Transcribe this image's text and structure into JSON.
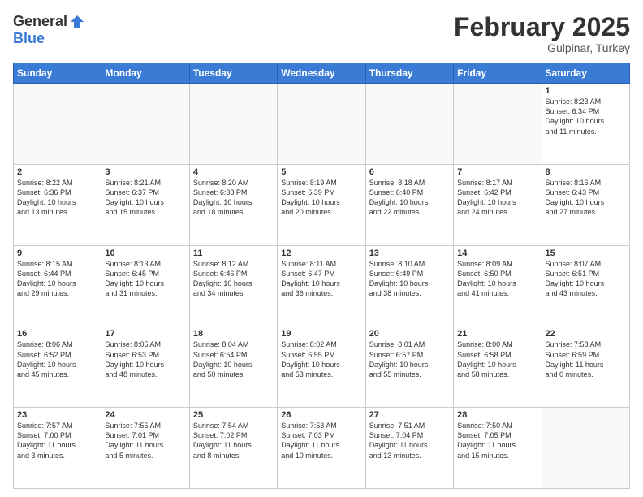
{
  "logo": {
    "general": "General",
    "blue": "Blue"
  },
  "header": {
    "title": "February 2025",
    "subtitle": "Gulpinar, Turkey"
  },
  "weekdays": [
    "Sunday",
    "Monday",
    "Tuesday",
    "Wednesday",
    "Thursday",
    "Friday",
    "Saturday"
  ],
  "weeks": [
    [
      {
        "day": "",
        "info": ""
      },
      {
        "day": "",
        "info": ""
      },
      {
        "day": "",
        "info": ""
      },
      {
        "day": "",
        "info": ""
      },
      {
        "day": "",
        "info": ""
      },
      {
        "day": "",
        "info": ""
      },
      {
        "day": "1",
        "info": "Sunrise: 8:23 AM\nSunset: 6:34 PM\nDaylight: 10 hours\nand 11 minutes."
      }
    ],
    [
      {
        "day": "2",
        "info": "Sunrise: 8:22 AM\nSunset: 6:36 PM\nDaylight: 10 hours\nand 13 minutes."
      },
      {
        "day": "3",
        "info": "Sunrise: 8:21 AM\nSunset: 6:37 PM\nDaylight: 10 hours\nand 15 minutes."
      },
      {
        "day": "4",
        "info": "Sunrise: 8:20 AM\nSunset: 6:38 PM\nDaylight: 10 hours\nand 18 minutes."
      },
      {
        "day": "5",
        "info": "Sunrise: 8:19 AM\nSunset: 6:39 PM\nDaylight: 10 hours\nand 20 minutes."
      },
      {
        "day": "6",
        "info": "Sunrise: 8:18 AM\nSunset: 6:40 PM\nDaylight: 10 hours\nand 22 minutes."
      },
      {
        "day": "7",
        "info": "Sunrise: 8:17 AM\nSunset: 6:42 PM\nDaylight: 10 hours\nand 24 minutes."
      },
      {
        "day": "8",
        "info": "Sunrise: 8:16 AM\nSunset: 6:43 PM\nDaylight: 10 hours\nand 27 minutes."
      }
    ],
    [
      {
        "day": "9",
        "info": "Sunrise: 8:15 AM\nSunset: 6:44 PM\nDaylight: 10 hours\nand 29 minutes."
      },
      {
        "day": "10",
        "info": "Sunrise: 8:13 AM\nSunset: 6:45 PM\nDaylight: 10 hours\nand 31 minutes."
      },
      {
        "day": "11",
        "info": "Sunrise: 8:12 AM\nSunset: 6:46 PM\nDaylight: 10 hours\nand 34 minutes."
      },
      {
        "day": "12",
        "info": "Sunrise: 8:11 AM\nSunset: 6:47 PM\nDaylight: 10 hours\nand 36 minutes."
      },
      {
        "day": "13",
        "info": "Sunrise: 8:10 AM\nSunset: 6:49 PM\nDaylight: 10 hours\nand 38 minutes."
      },
      {
        "day": "14",
        "info": "Sunrise: 8:09 AM\nSunset: 6:50 PM\nDaylight: 10 hours\nand 41 minutes."
      },
      {
        "day": "15",
        "info": "Sunrise: 8:07 AM\nSunset: 6:51 PM\nDaylight: 10 hours\nand 43 minutes."
      }
    ],
    [
      {
        "day": "16",
        "info": "Sunrise: 8:06 AM\nSunset: 6:52 PM\nDaylight: 10 hours\nand 45 minutes."
      },
      {
        "day": "17",
        "info": "Sunrise: 8:05 AM\nSunset: 6:53 PM\nDaylight: 10 hours\nand 48 minutes."
      },
      {
        "day": "18",
        "info": "Sunrise: 8:04 AM\nSunset: 6:54 PM\nDaylight: 10 hours\nand 50 minutes."
      },
      {
        "day": "19",
        "info": "Sunrise: 8:02 AM\nSunset: 6:55 PM\nDaylight: 10 hours\nand 53 minutes."
      },
      {
        "day": "20",
        "info": "Sunrise: 8:01 AM\nSunset: 6:57 PM\nDaylight: 10 hours\nand 55 minutes."
      },
      {
        "day": "21",
        "info": "Sunrise: 8:00 AM\nSunset: 6:58 PM\nDaylight: 10 hours\nand 58 minutes."
      },
      {
        "day": "22",
        "info": "Sunrise: 7:58 AM\nSunset: 6:59 PM\nDaylight: 11 hours\nand 0 minutes."
      }
    ],
    [
      {
        "day": "23",
        "info": "Sunrise: 7:57 AM\nSunset: 7:00 PM\nDaylight: 11 hours\nand 3 minutes."
      },
      {
        "day": "24",
        "info": "Sunrise: 7:55 AM\nSunset: 7:01 PM\nDaylight: 11 hours\nand 5 minutes."
      },
      {
        "day": "25",
        "info": "Sunrise: 7:54 AM\nSunset: 7:02 PM\nDaylight: 11 hours\nand 8 minutes."
      },
      {
        "day": "26",
        "info": "Sunrise: 7:53 AM\nSunset: 7:03 PM\nDaylight: 11 hours\nand 10 minutes."
      },
      {
        "day": "27",
        "info": "Sunrise: 7:51 AM\nSunset: 7:04 PM\nDaylight: 11 hours\nand 13 minutes."
      },
      {
        "day": "28",
        "info": "Sunrise: 7:50 AM\nSunset: 7:05 PM\nDaylight: 11 hours\nand 15 minutes."
      },
      {
        "day": "",
        "info": ""
      }
    ]
  ]
}
